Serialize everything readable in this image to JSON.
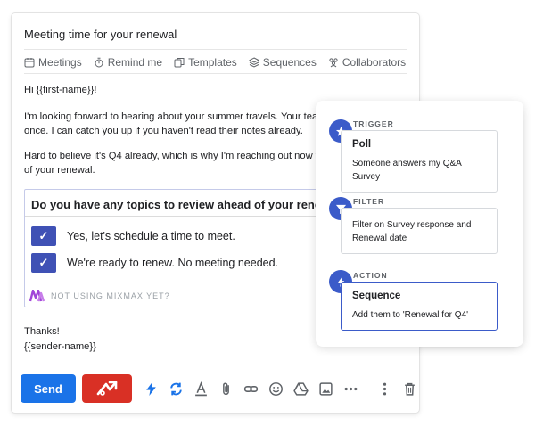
{
  "compose": {
    "subject": "Meeting time for your renewal",
    "toolbar": [
      {
        "label": "Meetings",
        "icon": "calendar-icon"
      },
      {
        "label": "Remind me",
        "icon": "alarm-icon"
      },
      {
        "label": "Templates",
        "icon": "templates-icon"
      },
      {
        "label": "Sequences",
        "icon": "layers-icon"
      },
      {
        "label": "Collaborators",
        "icon": "people-icon"
      }
    ],
    "body": {
      "greeting": "Hi {{first-name}}!",
      "para1_line1": "I'm looking forward to hearing about your summer travels. Your team and",
      "para1_line2": "once. I can catch you up if you haven't read their notes already.",
      "para2_line1": "Hard to believe it's Q4 already, which is why I'm reaching out now to sche",
      "para2_line2": "of your renewal."
    },
    "survey": {
      "question": "Do you have any topics to review ahead of your renewal",
      "options": [
        "Yes, let's schedule a time to meet.",
        "We're ready to renew. No meeting needed."
      ],
      "check_glyph": "✓",
      "footer": "NOT USING MIXMAX YET?"
    },
    "signoff": {
      "thanks": "Thanks!",
      "sender": "{{sender-name}}"
    },
    "send_label": "Send",
    "colors": {
      "send": "#1a73e8",
      "mixmax_button": "#d93025",
      "checkbox": "#3f51b5",
      "step_badge": "#3b5bc9"
    }
  },
  "workflow": {
    "steps": [
      {
        "kind": "TRIGGER",
        "title": "Poll",
        "description": "Someone answers my Q&A Survey",
        "icon": "star-icon"
      },
      {
        "kind": "FILTER",
        "title": "",
        "description_line1": "Filter on Survey response and",
        "description_line2": "Renewal date",
        "icon": "funnel-icon"
      },
      {
        "kind": "ACTION",
        "title": "Sequence",
        "description": "Add them to 'Renewal for Q4'",
        "icon": "lightning-icon"
      }
    ]
  }
}
